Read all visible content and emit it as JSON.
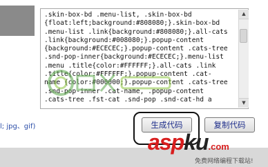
{
  "code": {
    "lines": [
      ".skin-box-bd .menu-list, .skin-box-bd",
      "{float:left;background:#808080;}.skin-box-bd",
      ".menu-list .link{background:#808080;}.all-cats",
      ".link{background:#008080;}.popup-content",
      "{background:#ECECEC;}.popup-content .cats-tree",
      ".snd-pop-inner{background:#ECECEC;}.menu-list",
      ".menu .title{color:#FFFFFF;}.all-cats .link",
      ".title{color:#FFFFFF;}.popup-content .cat-",
      "name {color:#000000;}.popup-content .cats-tree",
      ".snd-pop-inner .cat-name, .popup-content",
      ".cats-tree .fst-cat .snd-pop .snd-cat-hd a"
    ]
  },
  "file_hint": "l; jpg、gif)",
  "buttons": {
    "generate": "生成代码",
    "copy": "复制代码"
  },
  "logo": {
    "main": "asp",
    "ku": "ku",
    "com": ".com",
    "tagline": "免费网络编程下载站!"
  },
  "colors": {
    "logo_red": "#d81e1e",
    "button_text": "#1d2d8a",
    "link_blue": "#2b4da8"
  },
  "icons": [
    "scroll-up-icon",
    "scroll-down-icon",
    "watermark-logo"
  ]
}
